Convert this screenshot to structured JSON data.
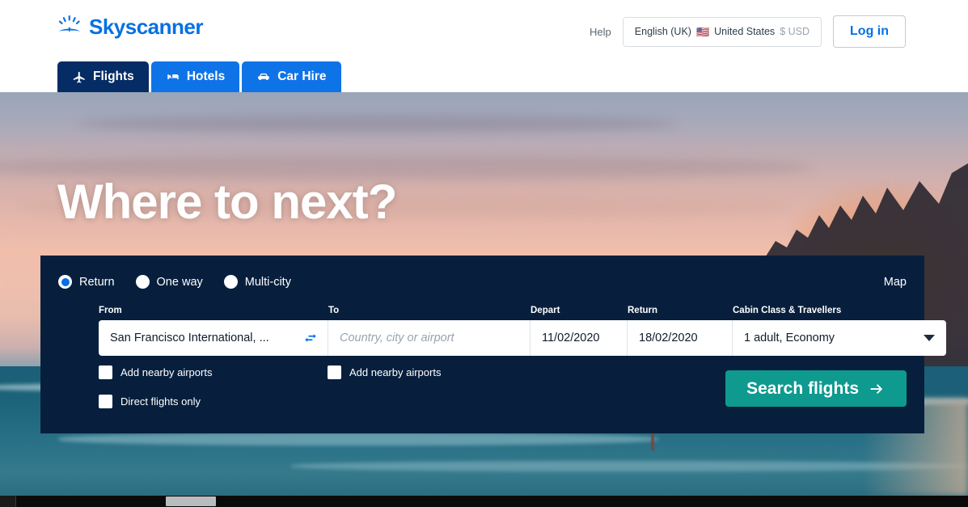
{
  "header": {
    "logo_text": "Skyscanner",
    "logo_icon": "skyscanner-sun-icon",
    "help_label": "Help",
    "locale": {
      "language": "English (UK)",
      "flag": "🇺🇸",
      "country": "United States",
      "currency": "$ USD"
    },
    "login_label": "Log in"
  },
  "nav": {
    "tabs": [
      {
        "label": "Flights",
        "icon": "plane-icon",
        "active": true
      },
      {
        "label": "Hotels",
        "icon": "bed-icon",
        "active": false
      },
      {
        "label": "Car Hire",
        "icon": "car-icon",
        "active": false
      }
    ]
  },
  "hero": {
    "title": "Where to next?"
  },
  "search": {
    "trip_types": [
      {
        "label": "Return",
        "selected": true
      },
      {
        "label": "One way",
        "selected": false
      },
      {
        "label": "Multi-city",
        "selected": false
      }
    ],
    "map_label": "Map",
    "labels": {
      "from": "From",
      "to": "To",
      "depart": "Depart",
      "return": "Return",
      "cabin": "Cabin Class & Travellers"
    },
    "fields": {
      "from_value": "San Francisco International, ...",
      "to_placeholder": "Country, city or airport",
      "depart_value": "11/02/2020",
      "return_value": "18/02/2020",
      "cabin_value": "1 adult, Economy"
    },
    "swap_icon": "swap-arrows-icon",
    "caret_icon": "chevron-down-icon",
    "checkboxes": [
      {
        "label": "Add nearby airports",
        "checked": false
      },
      {
        "label": "Add nearby airports",
        "checked": false
      },
      {
        "label": "Direct flights only",
        "checked": false
      }
    ],
    "submit_label": "Search flights",
    "submit_icon": "arrow-right-icon"
  },
  "colors": {
    "brand_blue": "#0770e3",
    "tab_active": "#052c65",
    "tab_inactive": "#0f73e8",
    "panel_navy": "#071f3d",
    "cta_teal": "#0e9a8f"
  }
}
